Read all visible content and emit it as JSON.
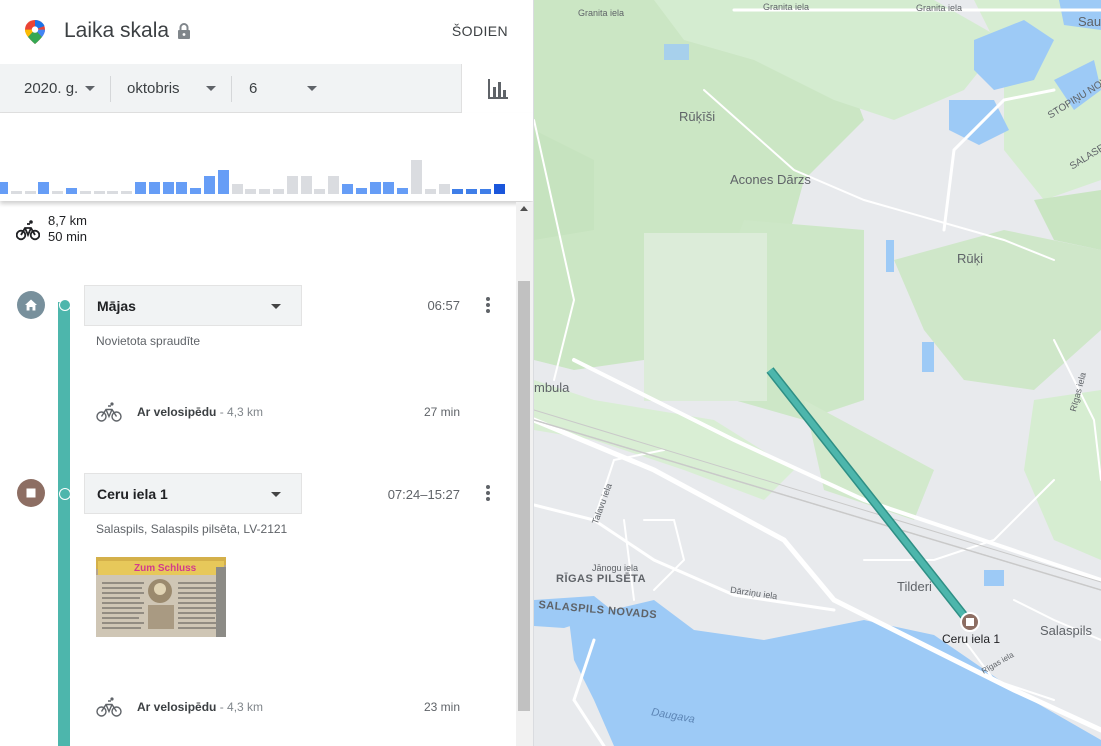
{
  "header": {
    "title": "Laika skala",
    "today_label": "ŠODIEN"
  },
  "date_selector": {
    "year": "2020. g.",
    "month": "oktobris",
    "day": "6"
  },
  "histogram": {
    "bars": [
      {
        "value": 12,
        "color": "#669df6"
      },
      {
        "value": 3,
        "color": "#dadce0"
      },
      {
        "value": 3,
        "color": "#dadce0"
      },
      {
        "value": 12,
        "color": "#669df6"
      },
      {
        "value": 3,
        "color": "#dadce0"
      },
      {
        "value": 6,
        "color": "#669df6"
      },
      {
        "value": 3,
        "color": "#dadce0"
      },
      {
        "value": 3,
        "color": "#dadce0"
      },
      {
        "value": 3,
        "color": "#dadce0"
      },
      {
        "value": 3,
        "color": "#dadce0"
      },
      {
        "value": 12,
        "color": "#669df6"
      },
      {
        "value": 12,
        "color": "#669df6"
      },
      {
        "value": 12,
        "color": "#669df6"
      },
      {
        "value": 12,
        "color": "#669df6"
      },
      {
        "value": 6,
        "color": "#669df6"
      },
      {
        "value": 18,
        "color": "#669df6"
      },
      {
        "value": 24,
        "color": "#669df6"
      },
      {
        "value": 10,
        "color": "#dadce0"
      },
      {
        "value": 5,
        "color": "#dadce0"
      },
      {
        "value": 5,
        "color": "#dadce0"
      },
      {
        "value": 5,
        "color": "#dadce0"
      },
      {
        "value": 18,
        "color": "#dadce0"
      },
      {
        "value": 18,
        "color": "#dadce0"
      },
      {
        "value": 5,
        "color": "#dadce0"
      },
      {
        "value": 18,
        "color": "#dadce0"
      },
      {
        "value": 10,
        "color": "#669df6"
      },
      {
        "value": 6,
        "color": "#669df6"
      },
      {
        "value": 12,
        "color": "#669df6"
      },
      {
        "value": 12,
        "color": "#669df6"
      },
      {
        "value": 6,
        "color": "#669df6"
      },
      {
        "value": 34,
        "color": "#dadce0"
      },
      {
        "value": 5,
        "color": "#dadce0"
      },
      {
        "value": 10,
        "color": "#dadce0"
      },
      {
        "value": 5,
        "color": "#3f7ee8"
      },
      {
        "value": 5,
        "color": "#3f7ee8"
      },
      {
        "value": 5,
        "color": "#3f7ee8"
      },
      {
        "value": 10,
        "color": "#1a56db"
      }
    ]
  },
  "summary": {
    "distance": "8,7 km",
    "duration": "50 min"
  },
  "timeline": {
    "place1": {
      "name": "Mājas",
      "time": "06:57",
      "subtitle": "Novietota spraudīte"
    },
    "activity1": {
      "label": "Ar velosipēdu",
      "distance": "- 4,3 km",
      "duration": "27 min"
    },
    "place2": {
      "name": "Ceru iela 1",
      "time": "07:24–15:27",
      "address": "Salaspils, Salaspils pilsēta, LV-2121",
      "photo_caption": "Zum Schluss"
    },
    "activity2": {
      "label": "Ar velosipēdu",
      "distance": "- 4,3 km",
      "duration": "23 min"
    }
  },
  "map": {
    "labels": {
      "granita_1": "Granita iela",
      "granita_2": "Granita iela",
      "granita_3": "Granita iela",
      "sau": "Sau",
      "rukisi": "Rūķīši",
      "acones": "Acones Dārzs",
      "stopinu": "STOPIŅU NOV.",
      "salasp_edge": "SALASPI",
      "ruki": "Rūķi",
      "rumbula": "mbula",
      "rigas_road": "Rīgas iela",
      "talavu": "Talavu iela",
      "janogu": "Jānogu iela",
      "rigas_pilseta": "RĪGAS PILSĒTA",
      "darzinu": "Dārziņu iela",
      "salaspils_novads": "SALASPILS NOVADS",
      "tilderi": "Tilderi",
      "ceru": "Ceru iela 1",
      "salaspils": "Salaspils",
      "rigas_iela_small": "Rīgas iela",
      "daugava": "Daugava"
    },
    "route_color": "#4db6ac",
    "water_color": "#9dcaf6",
    "park_color": "#c8e6c9"
  }
}
